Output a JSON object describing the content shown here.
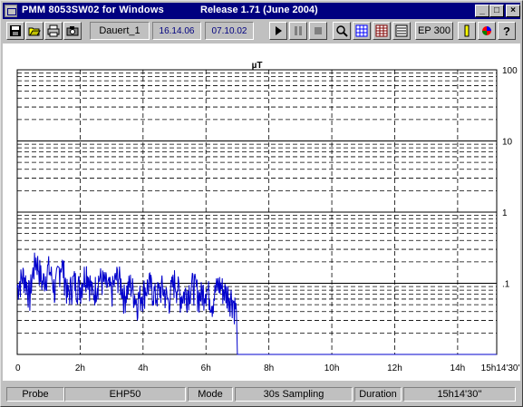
{
  "window": {
    "title": "PMM 8053SW02 for Windows",
    "release": "Release 1.71 (June 2004)",
    "controls": [
      "_",
      "□",
      "×"
    ]
  },
  "toolbar": {
    "station_name": "Dauert_1",
    "time": "16.14.06",
    "date": "07.10.02",
    "ep_label": "EP 300",
    "icons": [
      "save-icon",
      "open-icon",
      "print-icon",
      "camera-icon",
      "play-icon",
      "pause-icon",
      "stop-icon",
      "zoom-icon",
      "grid-icon",
      "table-icon",
      "list-icon",
      "probe-icon",
      "color-icon",
      "help-icon"
    ]
  },
  "plot": {
    "unit": "µT",
    "y_tick_labels": [
      "100",
      "10",
      "1",
      ".1"
    ],
    "x_tick_labels": [
      "0",
      "2h",
      "4h",
      "6h",
      "8h",
      "10h",
      "12h",
      "14h",
      "15h14'30''"
    ],
    "trace_color": "#0000cc"
  },
  "chart_data": {
    "type": "line",
    "title": "µT",
    "xlabel": "",
    "ylabel": "",
    "y_scale": "log",
    "ylim": [
      0.01,
      100
    ],
    "xlim_hours": [
      0,
      15.242
    ],
    "series": [
      {
        "values_hours": [
          0,
          0.2,
          0.4,
          0.6,
          0.8,
          1.0,
          1.2,
          1.4,
          1.6,
          1.8,
          2.0,
          2.2,
          2.4,
          2.6,
          2.8,
          3.0,
          3.2,
          3.4,
          3.6,
          3.8,
          4.0,
          4.2,
          4.4,
          4.6,
          4.8,
          5.0,
          5.2,
          5.4,
          5.6,
          5.8,
          6.0,
          6.2,
          6.4,
          6.6,
          6.8,
          6.95,
          7.0,
          15.24
        ],
        "values_uT": [
          0.08,
          0.12,
          0.06,
          0.2,
          0.09,
          0.15,
          0.07,
          0.18,
          0.06,
          0.1,
          0.08,
          0.14,
          0.06,
          0.11,
          0.09,
          0.07,
          0.12,
          0.06,
          0.09,
          0.05,
          0.07,
          0.09,
          0.06,
          0.08,
          0.05,
          0.1,
          0.06,
          0.07,
          0.09,
          0.06,
          0.08,
          0.05,
          0.09,
          0.07,
          0.06,
          0.04,
          0.01,
          0.01
        ]
      }
    ]
  },
  "statusbar": {
    "probe_label": "Probe",
    "probe_value": "EHP50",
    "mode_label": "Mode",
    "mode_value": "30s Sampling",
    "duration_label": "Duration",
    "duration_value": "15h14'30''"
  }
}
